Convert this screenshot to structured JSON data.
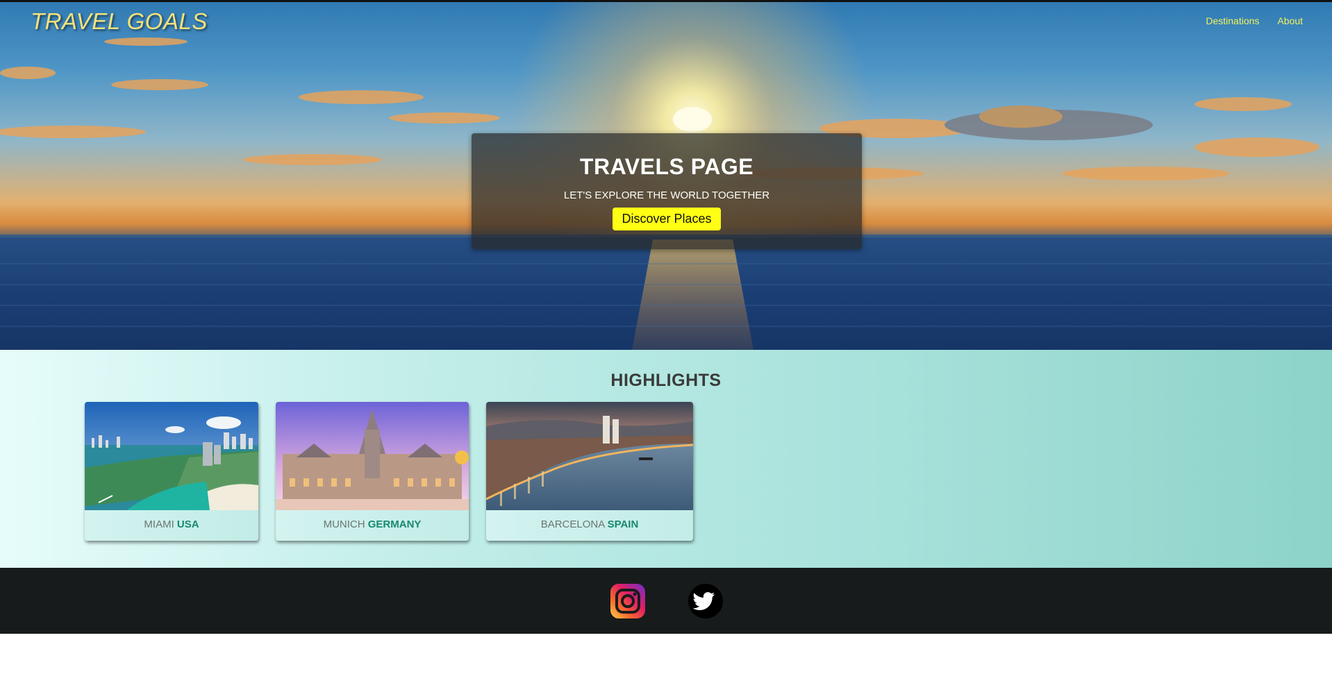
{
  "header": {
    "brand": "TRAVEL GOALS",
    "nav": [
      "Destinations",
      "About"
    ]
  },
  "hero": {
    "title": "TRAVELS PAGE",
    "subtitle": "LET'S EXPLORE THE WORLD TOGETHER",
    "button_label": "Discover Places"
  },
  "highlights": {
    "heading": "HIGHLIGHTS",
    "cards": [
      {
        "city": "MIAMI",
        "country": "USA"
      },
      {
        "city": "MUNICH",
        "country": "GERMANY"
      },
      {
        "city": "BARCELONA",
        "country": "SPAIN"
      }
    ]
  },
  "footer": {
    "icons": [
      "instagram-icon",
      "twitter-icon"
    ]
  },
  "colors": {
    "brand": "#f4e27a",
    "nav_link": "#f1f15a",
    "button": "#ffff14",
    "country_accent": "#18896d",
    "footer_bg": "#181b1b"
  }
}
